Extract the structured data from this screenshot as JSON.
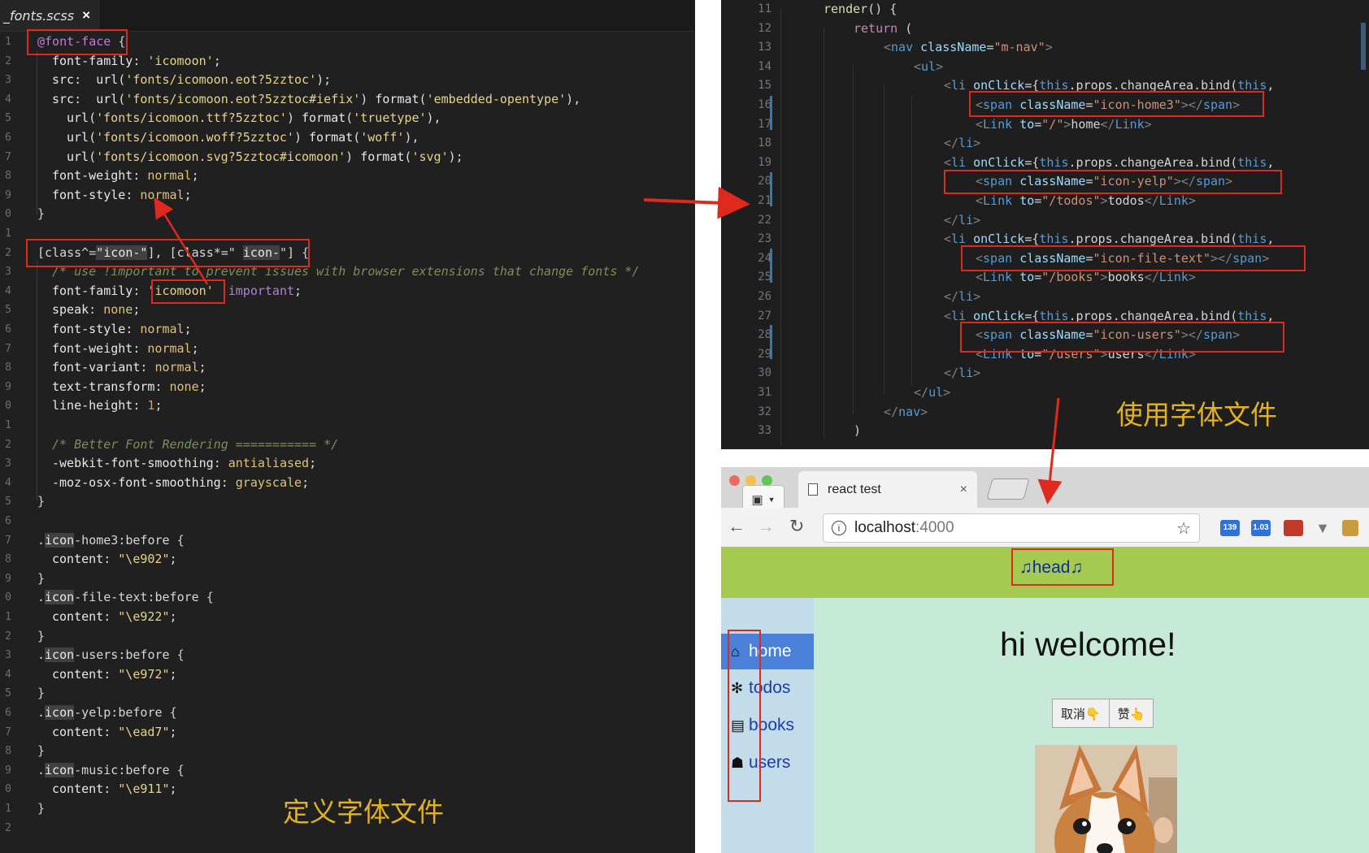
{
  "left_editor": {
    "tab_title": "_fonts.scss",
    "tab_close": "×",
    "line_numbers": [
      "1",
      "2",
      "3",
      "4",
      "5",
      "6",
      "7",
      "8",
      "9",
      "0",
      "1",
      "2",
      "3",
      "4",
      "5",
      "6",
      "7",
      "8",
      "9",
      "0",
      "1",
      "2",
      "3",
      "4",
      "5",
      "6",
      "7",
      "8",
      "9",
      "0",
      "1",
      "2",
      "3",
      "4",
      "5",
      "6",
      "7",
      "8",
      "9",
      "0",
      "1",
      "2"
    ],
    "caption": "定义字体文件"
  },
  "right_editor": {
    "line_numbers": [
      "11",
      "12",
      "13",
      "14",
      "15",
      "16",
      "17",
      "18",
      "19",
      "20",
      "21",
      "22",
      "23",
      "24",
      "25",
      "26",
      "27",
      "28",
      "29",
      "30",
      "31",
      "32",
      "33"
    ],
    "caption": "使用字体文件"
  },
  "browser": {
    "tab_title": "react test",
    "tab_close": "×",
    "url_host": "localhost",
    "url_port": ":4000",
    "nav_back_icon": "←",
    "nav_forward_icon": "→",
    "reload_icon": "↻",
    "star_icon": "☆",
    "info_icon": "i",
    "extensions": [
      "139",
      "1.03"
    ],
    "extension_colors": [
      "#2f72d8",
      "#2f72d8",
      "#c0392b",
      "#777777",
      "#c89b3c"
    ],
    "head_text": "♫head♫",
    "welcome": "hi welcome!",
    "nav_items": [
      {
        "label": "home",
        "icon": "home-icon",
        "glyph": "⌂"
      },
      {
        "label": "todos",
        "icon": "yelp-icon",
        "glyph": "✻"
      },
      {
        "label": "books",
        "icon": "file-text-icon",
        "glyph": "▤"
      },
      {
        "label": "users",
        "icon": "users-icon",
        "glyph": "☗"
      }
    ],
    "buttons": [
      {
        "label": "取消👇"
      },
      {
        "label": "赞👆"
      }
    ],
    "colors": {
      "head_bg": "#a4cb4f",
      "body_bg": "#c6e9d8",
      "sidebar_bg": "#c2dcea",
      "active_nav_bg": "#4a80d8",
      "annotation_red": "#e0291d",
      "caption_yellow": "#e4b21d"
    }
  }
}
